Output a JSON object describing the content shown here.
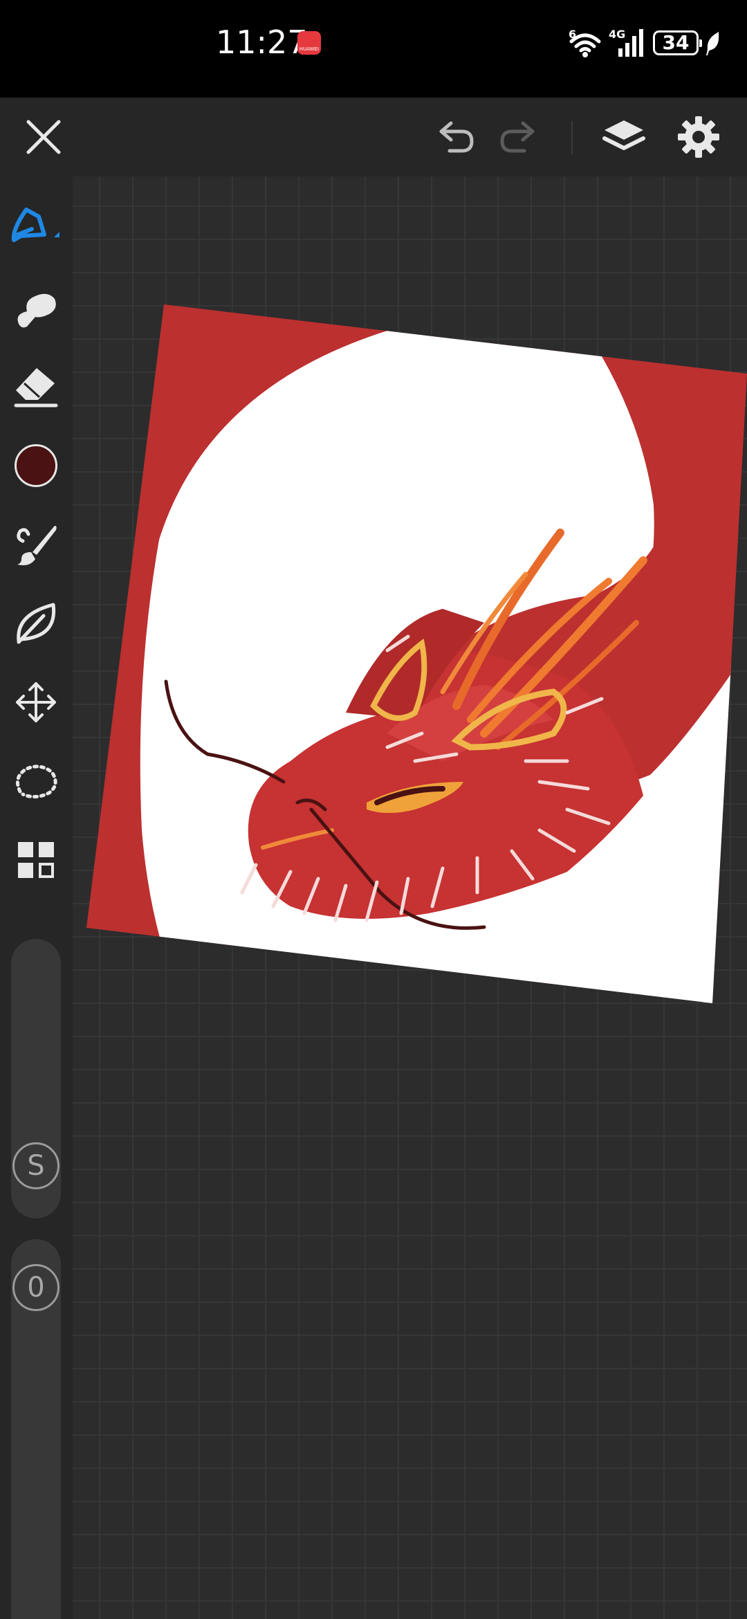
{
  "status_bar": {
    "time": "11:27",
    "app_badge": "HUAWEI",
    "wifi_label": "6",
    "network_type": "4G",
    "battery_level": "34"
  },
  "toolbar": {
    "close": "close-icon",
    "undo": "undo-icon",
    "redo": "redo-icon",
    "layers": "layers-icon",
    "settings": "gear-icon"
  },
  "tools": [
    "pen-icon",
    "smudge-icon",
    "eraser-icon",
    "color-swatch",
    "brush-icon",
    "leaf-icon",
    "move-icon",
    "lasso-icon",
    "grid-icon"
  ],
  "colors": {
    "current": "#4a1212",
    "accent": "#1e88e5",
    "canvas_red": "#bc3030",
    "panel": "#262626"
  },
  "size_slider": {
    "label": "S"
  },
  "opacity_slider": {
    "label": "0"
  }
}
